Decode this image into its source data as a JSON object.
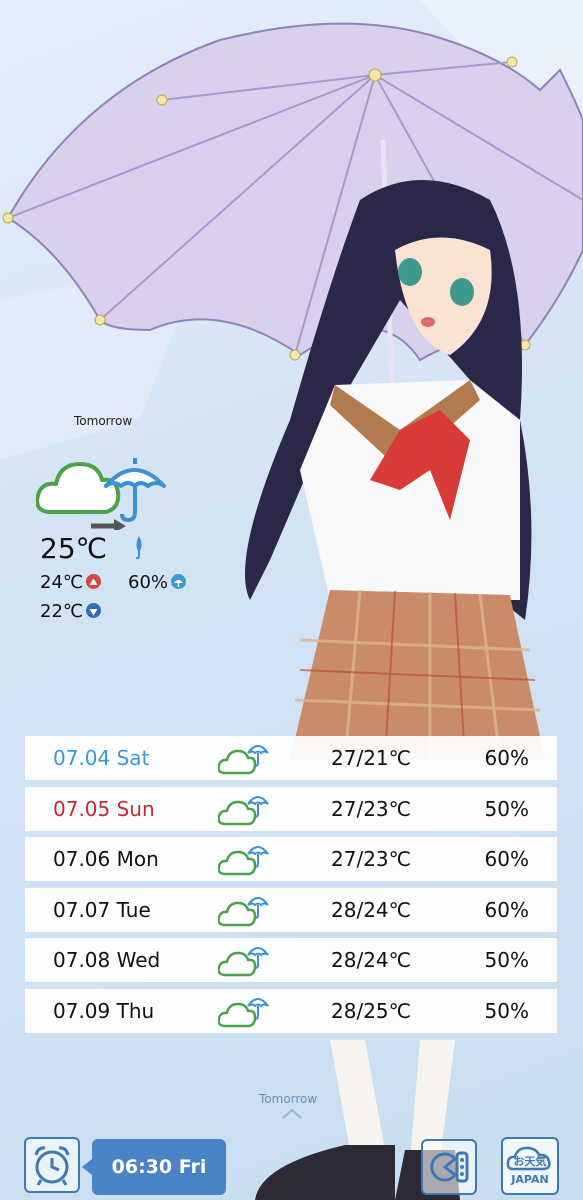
{
  "current": {
    "label": "Tomorrow",
    "temp": "25℃",
    "high": "24℃",
    "low": "22℃",
    "pop": "60%",
    "icon": "cloudy-then-rain-icon"
  },
  "forecast": [
    {
      "date": "07.04 Sat",
      "temp": "27/21℃",
      "pop": "60%",
      "icon": "cloud-rain-icon"
    },
    {
      "date": "07.05 Sun",
      "temp": "27/23℃",
      "pop": "50%",
      "icon": "cloud-rain-icon"
    },
    {
      "date": "07.06 Mon",
      "temp": "27/23℃",
      "pop": "60%",
      "icon": "cloud-rain-icon"
    },
    {
      "date": "07.07 Tue",
      "temp": "28/24℃",
      "pop": "60%",
      "icon": "cloud-rain-icon"
    },
    {
      "date": "07.08 Wed",
      "temp": "28/24℃",
      "pop": "50%",
      "icon": "cloud-rain-icon"
    },
    {
      "date": "07.09 Thu",
      "temp": "28/25℃",
      "pop": "50%",
      "icon": "cloud-rain-icon"
    }
  ],
  "bottom": {
    "tomorrow_hint": "Tomorrow",
    "alarm_time": "06:30 Fri",
    "logo_line1": "お天気",
    "logo_line2": "JAPAN"
  },
  "colors": {
    "saturday": "#3a97d8",
    "sunday": "#c62b35",
    "cloud": "#4aa34a",
    "umbrella": "#3d8fd6",
    "accent": "#4a84c6"
  }
}
